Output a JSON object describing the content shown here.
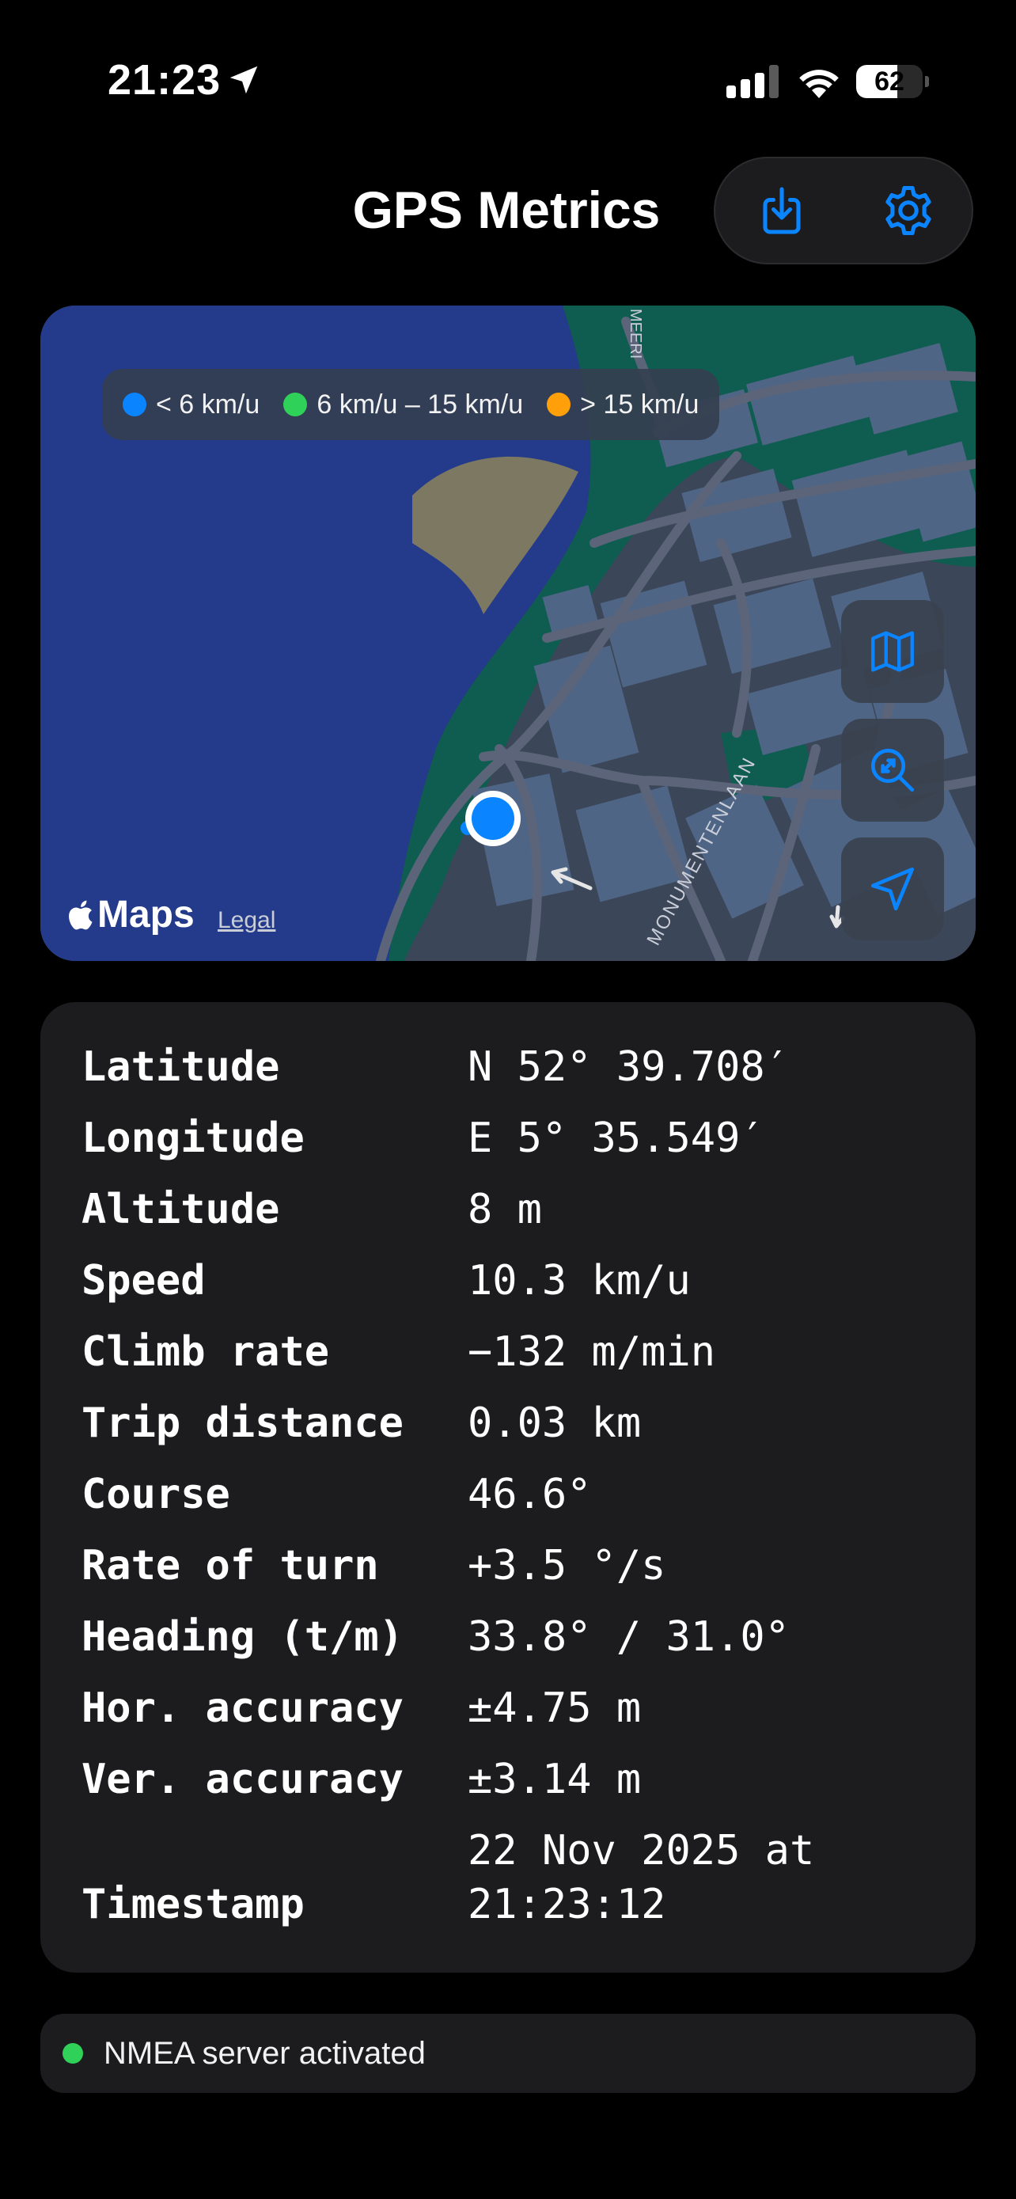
{
  "status_bar": {
    "time": "21:23",
    "battery": "62",
    "battery_fraction": 0.62,
    "icons": [
      "location-arrow-icon",
      "cellular-signal-icon",
      "wifi-icon",
      "battery-icon"
    ]
  },
  "header": {
    "title": "GPS Metrics",
    "export_icon": "download-tray-icon",
    "settings_icon": "gear-icon"
  },
  "colors": {
    "accent": "#0a84ff",
    "slow": "#0a84ff",
    "medium": "#30d158",
    "fast": "#ff9f0a",
    "background": "#000000",
    "card": "#1c1c1e",
    "water": "#243a8a",
    "park": "#0f5c50",
    "land": "#3b4658",
    "buildings": "#4f6585",
    "beach": "#7d7862"
  },
  "map": {
    "legend": [
      {
        "label": "< 6 km/u",
        "color": "#0a84ff"
      },
      {
        "label": "6 km/u – 15 km/u",
        "color": "#30d158"
      },
      {
        "label": "> 15 km/u",
        "color": "#ff9f0a"
      }
    ],
    "street_labels": [
      "MEERI",
      "MONUMENTENLAAN"
    ],
    "attribution": "Maps",
    "legal": "Legal",
    "controls": [
      "map-icon",
      "zoom-to-fit-icon",
      "location-arrow-icon"
    ]
  },
  "metrics": [
    {
      "label": "Latitude",
      "value": "N 52° 39.708′"
    },
    {
      "label": "Longitude",
      "value": "E 5° 35.549′"
    },
    {
      "label": "Altitude",
      "value": "8 m"
    },
    {
      "label": "Speed",
      "value": "10.3 km/u"
    },
    {
      "label": "Climb rate",
      "value": "−132 m/min"
    },
    {
      "label": "Trip distance",
      "value": "0.03 km"
    },
    {
      "label": "Course",
      "value": "46.6°"
    },
    {
      "label": "Rate of turn",
      "value": "+3.5 °/s"
    },
    {
      "label": "Heading (t/m)",
      "value": "33.8° / 31.0°"
    },
    {
      "label": "Hor. accuracy",
      "value": "±4.75 m"
    },
    {
      "label": "Ver. accuracy",
      "value": "±3.14 m"
    },
    {
      "label": "Timestamp",
      "value": "22 Nov 2025 at 21:23:12"
    }
  ],
  "server": {
    "status": "NMEA server activated",
    "color": "#30d158"
  }
}
